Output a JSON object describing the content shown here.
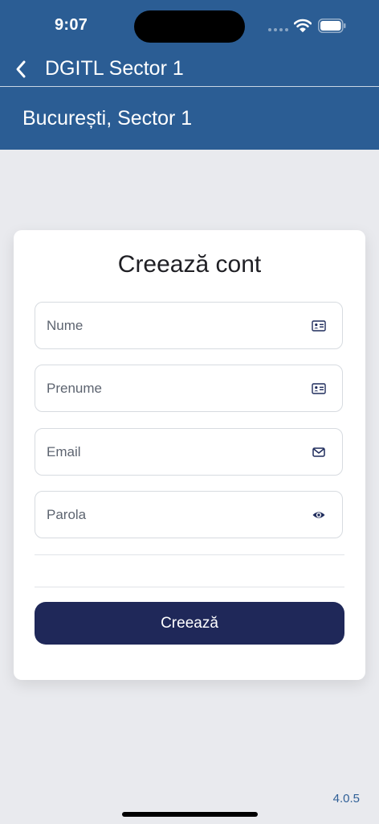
{
  "status_bar": {
    "time": "9:07",
    "icons": [
      "cellular-signal-icon",
      "wifi-icon",
      "battery-icon"
    ]
  },
  "nav": {
    "back_icon": "chevron-left-icon",
    "title": "DGITL Sector 1"
  },
  "location": {
    "title": "București, Sector 1"
  },
  "form": {
    "title": "Creează cont",
    "fields": [
      {
        "placeholder": "Nume",
        "value": "",
        "icon": "id-card-icon"
      },
      {
        "placeholder": "Prenume",
        "value": "",
        "icon": "id-card-icon"
      },
      {
        "placeholder": "Email",
        "value": "",
        "icon": "envelope-icon"
      },
      {
        "placeholder": "Parola",
        "value": "",
        "icon": "eye-icon"
      }
    ],
    "submit_label": "Creează"
  },
  "footer": {
    "version": "4.0.5"
  },
  "colors": {
    "header": "#2b5d94",
    "background": "#e9eaee",
    "card": "#ffffff",
    "button": "#1f2859",
    "icon": "#1f2c5c",
    "version_text": "#2f5f96"
  }
}
